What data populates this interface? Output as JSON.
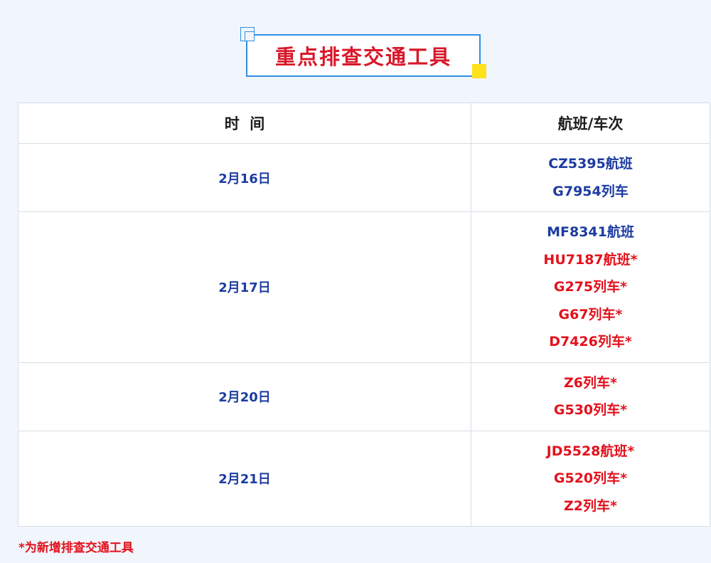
{
  "title": "重点排查交通工具",
  "table": {
    "headers": [
      "时  间",
      "航班/车次"
    ],
    "rows": [
      {
        "date": "2月16日",
        "items": [
          {
            "text": "CZ5395航班",
            "new": false
          },
          {
            "text": "G7954列车",
            "new": false
          }
        ]
      },
      {
        "date": "2月17日",
        "items": [
          {
            "text": "MF8341航班",
            "new": false
          },
          {
            "text": "HU7187航班*",
            "new": true
          },
          {
            "text": "G275列车*",
            "new": true
          },
          {
            "text": "G67列车*",
            "new": true
          },
          {
            "text": "D7426列车*",
            "new": true
          }
        ]
      },
      {
        "date": "2月20日",
        "items": [
          {
            "text": "Z6列车*",
            "new": true
          },
          {
            "text": "G530列车*",
            "new": true
          }
        ]
      },
      {
        "date": "2月21日",
        "items": [
          {
            "text": "JD5528航班*",
            "new": true
          },
          {
            "text": "G520列车*",
            "new": true
          },
          {
            "text": "Z2列车*",
            "new": true
          }
        ]
      }
    ]
  },
  "footnote": "*为新增排查交通工具",
  "colors": {
    "title_red": "#d8182a",
    "existing_blue": "#1c3ca1",
    "new_red": "#e3111c",
    "frame_blue": "#2f8fe0",
    "accent_yellow": "#ffe11b"
  }
}
